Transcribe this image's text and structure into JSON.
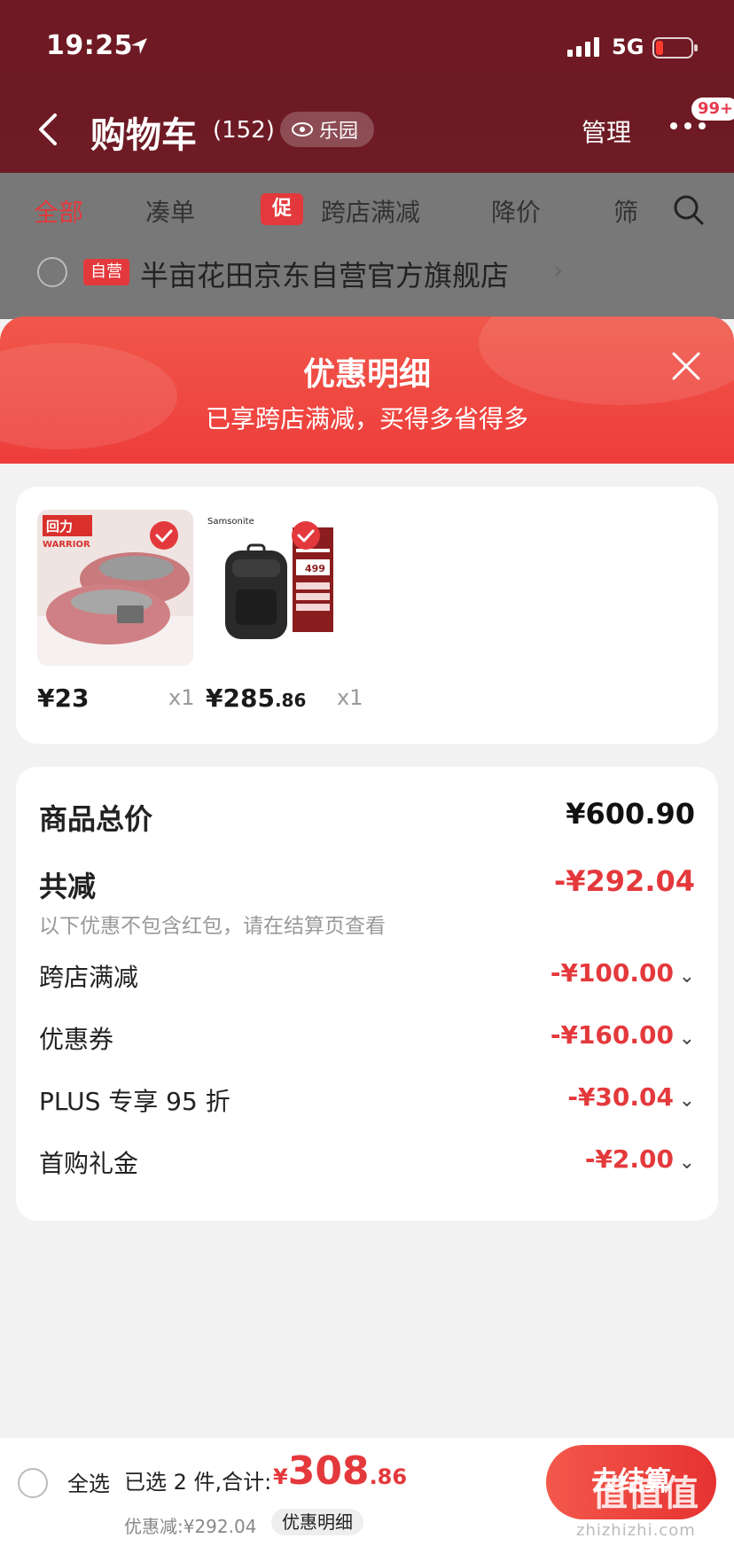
{
  "status_bar": {
    "time": "19:25",
    "network": "5G"
  },
  "cart_header": {
    "title": "购物车",
    "count": "(152)",
    "paradise_label": "乐园",
    "manage_label": "管理",
    "badge": "99+"
  },
  "filter_tabs": [
    {
      "label": "全部",
      "active": true
    },
    {
      "label": "凑单"
    },
    {
      "label": "跨店满减",
      "tag": "促"
    },
    {
      "label": "降价"
    },
    {
      "label": "筛"
    }
  ],
  "store": {
    "tag": "自营",
    "name": "半亩花田京东自营官方旗舰店",
    "chevron": "›"
  },
  "sheet": {
    "title": "优惠明细",
    "subtitle": "已享跨店满减，买得多省得多"
  },
  "products": [
    {
      "name": "slippers",
      "price": "¥23",
      "price_decimal": "",
      "qty": "x1",
      "brand_text": "回力",
      "brand_sub": "WARRIOR"
    },
    {
      "name": "backpack",
      "price": "¥285",
      "price_decimal": ".86",
      "qty": "x1",
      "brand_text": "Samsonite",
      "promo_price": "499"
    }
  ],
  "summary": {
    "goods_total_label": "商品总价",
    "goods_total_value": "¥600.90",
    "total_reduce_label": "共减",
    "total_reduce_value": "-¥292.04",
    "hint": "以下优惠不包含红包，请在结算页查看",
    "items": [
      {
        "label": "跨店满减",
        "value": "-¥100.00"
      },
      {
        "label": "优惠券",
        "value": "-¥160.00"
      },
      {
        "label": "PLUS 专享 95 折",
        "value": "-¥30.04"
      },
      {
        "label": "首购礼金",
        "value": "-¥2.00"
      }
    ]
  },
  "bottom_bar": {
    "select_all": "全选",
    "selected_info": "已选 2 件,合计:",
    "total_currency": "¥",
    "total_int": "308",
    "total_dec": ".86",
    "save_text": "优惠减:¥292.04",
    "detail_chip": "优惠明细",
    "checkout_label": "去结算",
    "watermark": "值值值",
    "watermark_sub": "zhizhizhi.com"
  },
  "colors": {
    "brand_red": "#e4393c",
    "header_red": "#e6344a",
    "sheet_red": "#ee3d3b"
  }
}
